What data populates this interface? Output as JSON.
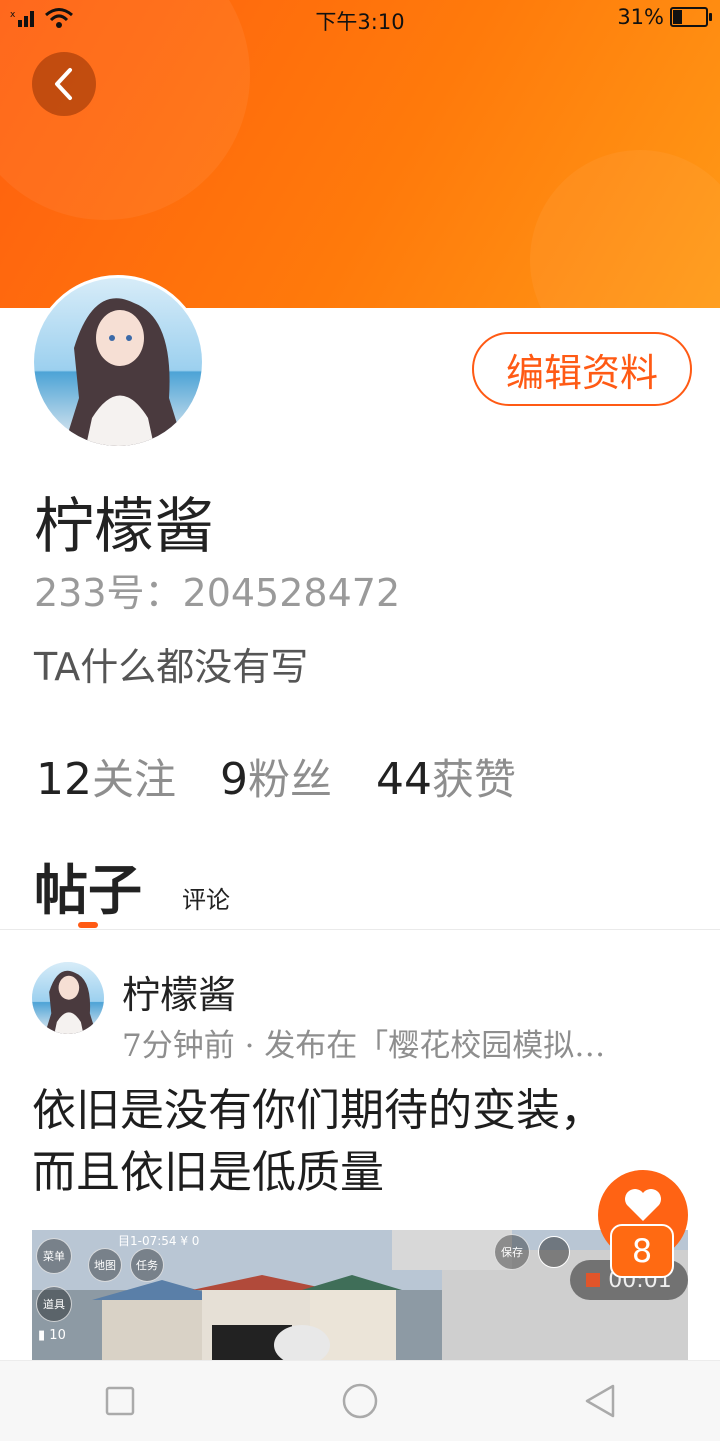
{
  "status_bar": {
    "time": "下午3:10",
    "battery": "31%",
    "battery_level": 0.31
  },
  "header": {
    "back_icon": "chevron-left-icon"
  },
  "profile": {
    "edit_button": "编辑资料",
    "username": "柠檬酱",
    "id_text": "233号：204528472",
    "bio": "TA什么都没有写",
    "stats": [
      {
        "num": "12",
        "label": "关注"
      },
      {
        "num": "9",
        "label": "粉丝"
      },
      {
        "num": "44",
        "label": "获赞"
      }
    ]
  },
  "tabs": {
    "posts": "帖子",
    "comments": "评论"
  },
  "post": {
    "author": "柠檬酱",
    "meta": "7分钟前 · 发布在「樱花校园模拟…",
    "title": "依旧是没有你们期待的变装，而且依旧是低质量",
    "video_overlay": {
      "hud_top": "目1-07:54  ¥ 0",
      "buttons": [
        "菜单",
        "地图",
        "任务",
        "道具"
      ],
      "save": "保存",
      "likes": "10",
      "timer": "00:01"
    }
  },
  "fab": {
    "icon": "heart-icon",
    "count": "8"
  },
  "nav": {
    "icons": [
      "square-icon",
      "circle-icon",
      "triangle-back-icon"
    ]
  },
  "colors": {
    "accent": "#ff5a14",
    "header_start": "#ff5f0f",
    "header_end": "#ff9a16"
  }
}
